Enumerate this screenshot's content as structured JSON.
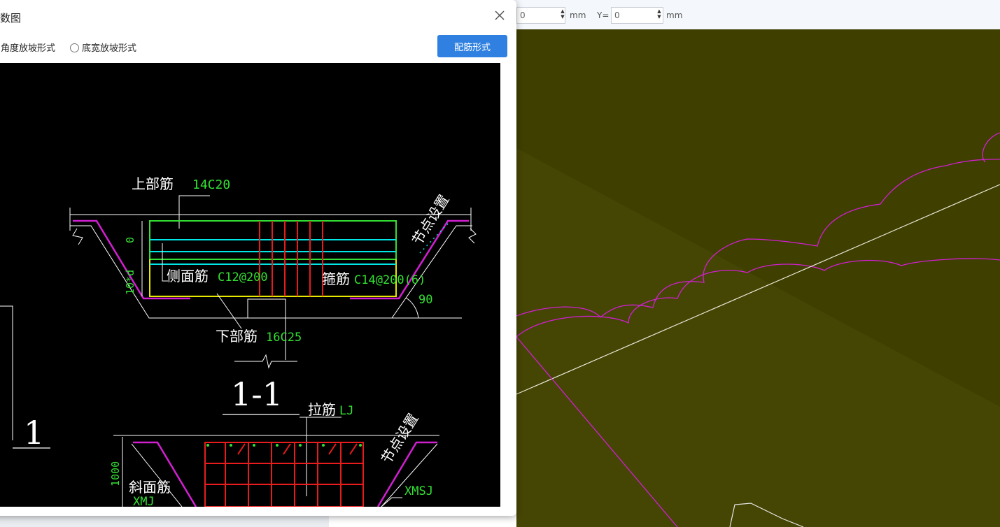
{
  "coords": {
    "x_value": "0",
    "x_unit": "mm",
    "y_label": "Y=",
    "y_value": "0",
    "y_unit": "mm"
  },
  "dialog": {
    "title": "数图",
    "close_glyph": "✕",
    "radio_angle": "角度放坡形式",
    "radio_width": "底宽放坡形式",
    "rebar_button": "配筋形式"
  },
  "drawing": {
    "top_bar_label": "上部筋",
    "top_bar_value": "14C20",
    "node_setting_top": "节点设置",
    "dim_zero": "0",
    "dim_lad": "10*d",
    "side_bar_label": "侧面筋",
    "side_bar_value": "C12@200",
    "stirrup_label": "箍筋",
    "stirrup_value": "C14@200(6)",
    "angle_value": "90",
    "bottom_bar_label": "下部筋",
    "bottom_bar_value": "16C25",
    "section_label": "1-1",
    "left_section_mark": "1",
    "tie_bar_label": "拉筋",
    "tie_bar_value": "LJ",
    "node_setting_bottom": "节点设置",
    "slope_bar_label": "斜面筋",
    "slope_bar_value": "XMJ",
    "xmsj_value": "XMSJ",
    "dim_1000": "1000"
  },
  "colors": {
    "viewport_bg": "#3f3f00",
    "magenta": "#d21fd2",
    "cad_green": "#33e033",
    "cad_yellow": "#e8e800",
    "cad_cyan": "#00e5e5",
    "cad_red": "#e81c1c",
    "accent_blue": "#2f80e0"
  }
}
